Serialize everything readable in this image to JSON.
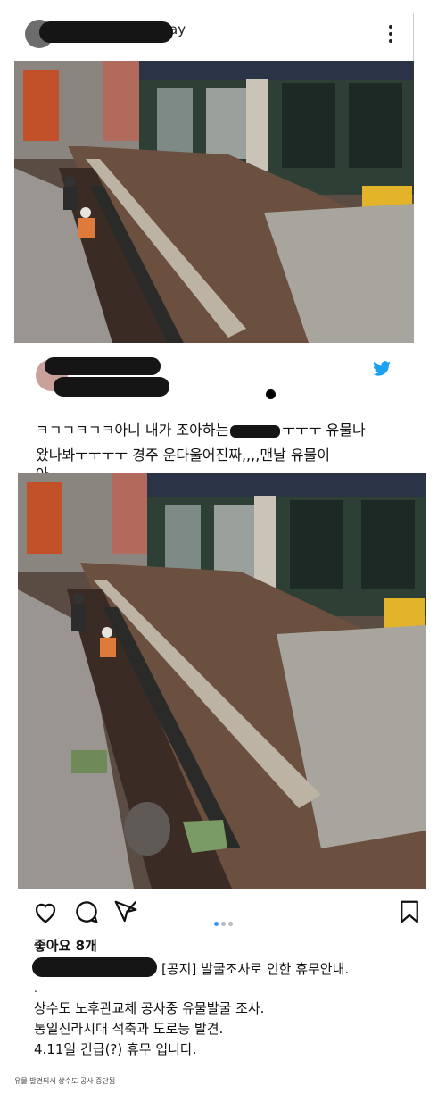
{
  "post": {
    "username": "ay",
    "likes": "좋아요 8개",
    "caption_notice": "[공지] 발굴조사로 인한 휴무안내.",
    "caption_dot": ".",
    "body": [
      "상수도 노후관교체 공사중 유물발굴 조사.",
      "통일신라시대 석축과 도로등 발견.",
      "4.11일 긴급(?) 휴무 입니다."
    ],
    "carousel": {
      "count": 3,
      "active": 0
    }
  },
  "tweet": {
    "line1": "ㅋㄱㄱㅋㄱㅋ아니 내가 조아하는",
    "line1_end": "ㅜㅜㅜ 유물나",
    "line2": "왔나봐ㅜㅜㅜㅜ 경주 운다울어진짜,,,,맨날 유물이",
    "line3": "아"
  },
  "footnote": "유물 발견되서 상수도 공사 중단됨",
  "colors": {
    "twitter_blue": "#1da1f2",
    "carousel_active": "#3897f0",
    "redaction": "#151515"
  },
  "icons": [
    "more-options-icon",
    "twitter-bird-icon",
    "heart-icon",
    "comment-icon",
    "share-icon",
    "bookmark-icon"
  ]
}
